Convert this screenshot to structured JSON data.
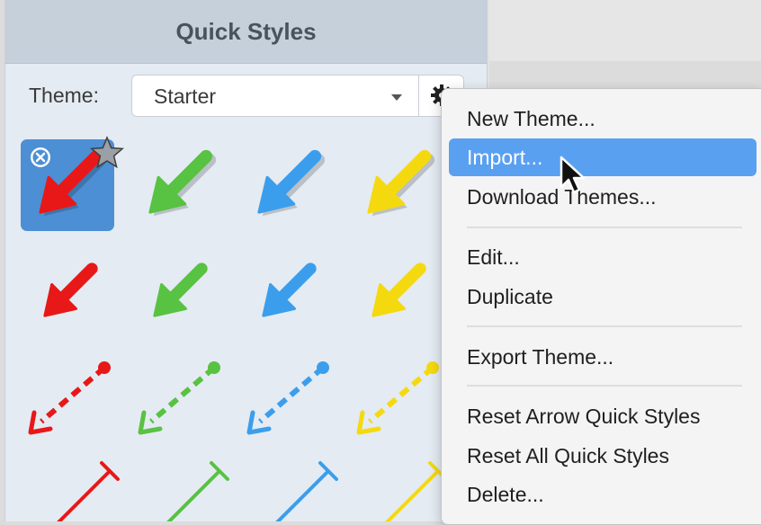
{
  "panel": {
    "title": "Quick Styles"
  },
  "theme": {
    "label": "Theme:",
    "value": "Starter"
  },
  "styles": {
    "colors": [
      "#e81818",
      "#58c242",
      "#3b9eec",
      "#f5d90f"
    ],
    "rows": [
      "solid arrow with shadow",
      "solid arrow",
      "dashed arrow with dot",
      "line with bar end"
    ],
    "selected": {
      "row": 0,
      "column": 0,
      "background": "#4c8fd4"
    }
  },
  "menu": {
    "items": [
      {
        "label": "New Theme...",
        "active": false
      },
      {
        "label": "Import...",
        "active": true
      },
      {
        "label": "Download Themes...",
        "active": false
      },
      {
        "label": "Edit...",
        "active": false
      },
      {
        "label": "Duplicate",
        "active": false
      },
      {
        "label": "Export Theme...",
        "active": false
      },
      {
        "label": "Reset Arrow Quick Styles",
        "active": false
      },
      {
        "label": "Reset All Quick Styles",
        "active": false
      },
      {
        "label": "Delete...",
        "active": false
      }
    ],
    "highlight_color": "#5aa0f1"
  },
  "icons": [
    "gear-icon",
    "close-icon",
    "star-icon",
    "chevron-down-icon",
    "mouse-cursor-icon"
  ]
}
